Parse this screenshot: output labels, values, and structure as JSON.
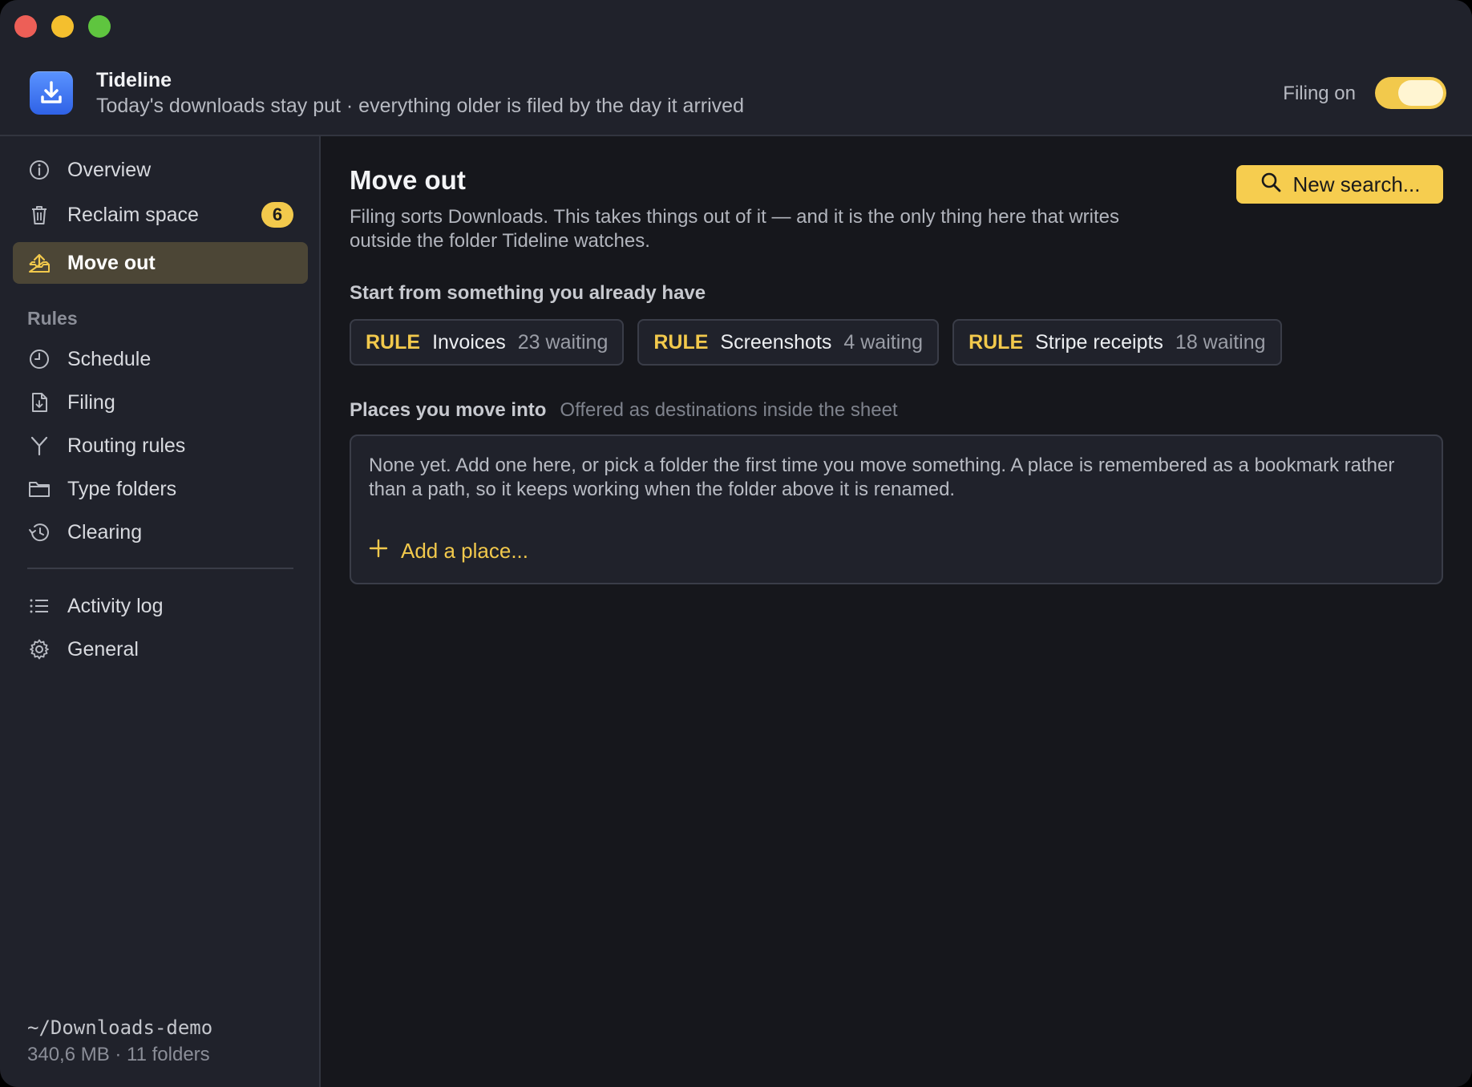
{
  "app": {
    "title": "Tideline",
    "subtitle": "Today's downloads stay put · everything older is filed by the day it arrived",
    "filing_toggle_label": "Filing on",
    "filing_enabled": true
  },
  "sidebar": {
    "primary": [
      {
        "label": "Overview",
        "icon": "info-icon"
      },
      {
        "label": "Reclaim space",
        "icon": "trash-icon",
        "badge": "6"
      },
      {
        "label": "Move out",
        "icon": "export-tray-icon",
        "active": true
      }
    ],
    "rules_section_label": "Rules",
    "rules": [
      {
        "label": "Schedule",
        "icon": "clock-icon"
      },
      {
        "label": "Filing",
        "icon": "document-download-icon"
      },
      {
        "label": "Routing rules",
        "icon": "fork-icon"
      },
      {
        "label": "Type folders",
        "icon": "folder-icon"
      },
      {
        "label": "Clearing",
        "icon": "history-icon"
      }
    ],
    "other": [
      {
        "label": "Activity log",
        "icon": "list-icon"
      },
      {
        "label": "General",
        "icon": "gear-icon"
      }
    ],
    "footer": {
      "path": "~/Downloads-demo",
      "stats": "340,6 MB · 11 folders"
    }
  },
  "main": {
    "title": "Move out",
    "description": "Filing sorts Downloads. This takes things out of it — and it is the only thing here that writes outside the folder Tideline watches.",
    "search_button_label": "New search...",
    "start_heading": "Start from something you already have",
    "rule_chips": [
      {
        "tag": "RULE",
        "name": "Invoices",
        "count": "23 waiting"
      },
      {
        "tag": "RULE",
        "name": "Screenshots",
        "count": "4 waiting"
      },
      {
        "tag": "RULE",
        "name": "Stripe receipts",
        "count": "18 waiting"
      }
    ],
    "places_heading": "Places you move into",
    "places_hint": "Offered as destinations inside the sheet",
    "places_empty_text": "None yet. Add one here, or pick a folder the first time you move something. A place is remembered as a bookmark rather than a path, so it keeps working when the folder above it is renamed.",
    "add_place_label": "Add a place..."
  },
  "colors": {
    "accent": "#f2c94c",
    "window_bg": "#16171c",
    "sidebar_bg": "#20222b",
    "active_item_bg": "#4c4636"
  }
}
